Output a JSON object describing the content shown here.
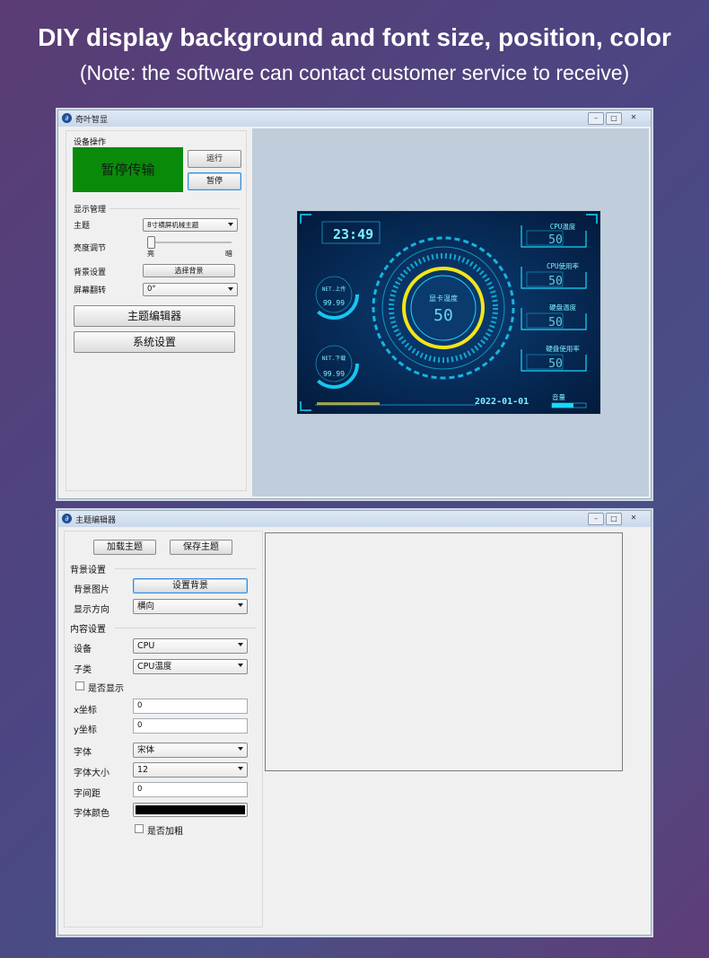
{
  "banner": {
    "title": "DIY display background and font size, position, color",
    "subtitle": "(Note: the software can contact customer service to receive)"
  },
  "main_window": {
    "title": "奇叶智显",
    "device_ops": {
      "group": "设备操作",
      "status": "暂停传输",
      "run": "运行",
      "pause": "暂停"
    },
    "display_mgmt": {
      "group": "显示管理",
      "theme_label": "主题",
      "theme_value": "8寸横屏机械主题",
      "brightness_label": "亮度调节",
      "bright_high": "亮",
      "bright_low": "暗",
      "bg_label": "背景设置",
      "bg_button": "选择背景",
      "rotate_label": "屏幕翻转",
      "rotate_value": "0°"
    },
    "theme_editor_button": "主题编辑器",
    "system_settings_button": "系统设置",
    "preview": {
      "clock": "23:49",
      "net_up_label": "NET.上传",
      "net_up_value": "99.99",
      "net_down_label": "NET.下载",
      "net_down_value": "99.99",
      "gpu_label": "显卡温度",
      "gpu_value": "50",
      "cpu_temp_label": "CPU温度",
      "cpu_temp_value": "50",
      "cpu_use_label": "CPU使用率",
      "cpu_use_value": "50",
      "disk_temp_label": "硬盘温度",
      "disk_temp_value": "50",
      "disk_use_label": "硬盘使用率",
      "disk_use_value": "50",
      "date": "2022-01-01",
      "volume_label": "音量"
    }
  },
  "editor_window": {
    "title": "主题编辑器",
    "load_button": "加载主题",
    "save_button": "保存主题",
    "bg_group": "背景设置",
    "bg_image_label": "背景图片",
    "bg_image_button": "设置背景",
    "orientation_label": "显示方向",
    "orientation_value": "横向",
    "content_group": "内容设置",
    "device_label": "设备",
    "device_value": "CPU",
    "subclass_label": "子类",
    "subclass_value": "CPU温度",
    "show_label": "是否显示",
    "x_label": "x坐标",
    "x_value": "0",
    "y_label": "y坐标",
    "y_value": "0",
    "font_label": "字体",
    "font_value": "宋体",
    "font_size_label": "字体大小",
    "font_size_value": "12",
    "spacing_label": "字间距",
    "spacing_value": "0",
    "font_color_label": "字体颜色",
    "font_color_value": "#000000",
    "bold_label": "是否加粗"
  }
}
